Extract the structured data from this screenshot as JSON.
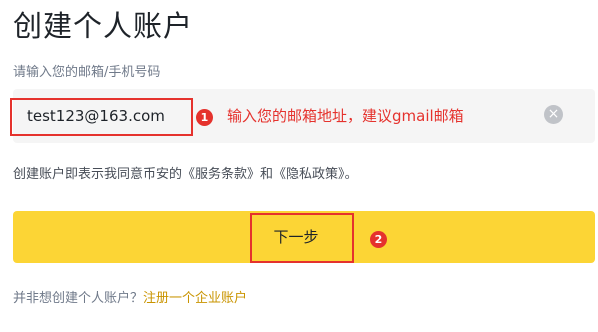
{
  "page": {
    "title": "创建个人账户"
  },
  "email": {
    "label": "请输入您的邮箱/手机号码",
    "value": "test123@163.com",
    "clear_icon": "clear-circle-icon"
  },
  "annotations": {
    "step1_badge": "1",
    "step1_text": "输入您的邮箱地址，建议gmail邮箱",
    "step2_badge": "2",
    "color": "#e5322d"
  },
  "terms": {
    "prefix": "创建账户即表示我同意币安的",
    "service_link": "《服务条款》",
    "middle": "和",
    "privacy_link": "《隐私政策》",
    "suffix": "。"
  },
  "next_button": {
    "label": "下一步",
    "color": "#fcd535"
  },
  "footer": {
    "question": "并非想创建个人账户？",
    "corporate_link": "注册一个企业账户",
    "link_color": "#c99400"
  }
}
